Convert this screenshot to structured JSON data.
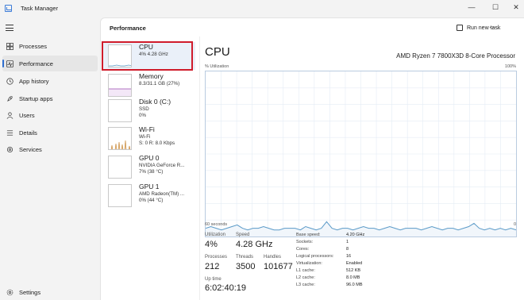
{
  "app": {
    "title": "Task Manager"
  },
  "window_controls": {
    "minimize": "—",
    "maximize": "☐",
    "close": "✕"
  },
  "nav": {
    "items": [
      {
        "label": "Processes"
      },
      {
        "label": "Performance"
      },
      {
        "label": "App history"
      },
      {
        "label": "Startup apps"
      },
      {
        "label": "Users"
      },
      {
        "label": "Details"
      },
      {
        "label": "Services"
      }
    ],
    "settings": "Settings",
    "active_index": 1
  },
  "header": {
    "title": "Performance",
    "run_task": "Run new task",
    "more": "···"
  },
  "resources": [
    {
      "name": "CPU",
      "line1": "4% 4.28 GHz",
      "line2": "",
      "line3": ""
    },
    {
      "name": "Memory",
      "line1": "8.3/31.1 GB (27%)",
      "line2": "",
      "line3": ""
    },
    {
      "name": "Disk 0 (C:)",
      "line1": "SSD",
      "line2": "0%",
      "line3": ""
    },
    {
      "name": "Wi-Fi",
      "line1": "Wi-Fi",
      "line2": "S: 0 R: 8.0 Kbps",
      "line3": ""
    },
    {
      "name": "GPU 0",
      "line1": "NVIDIA GeForce R...",
      "line2": "7% (38 °C)",
      "line3": ""
    },
    {
      "name": "GPU 1",
      "line1": "AMD Radeon(TM) ...",
      "line2": "0% (44 °C)",
      "line3": ""
    }
  ],
  "detail": {
    "title": "CPU",
    "processor": "AMD Ryzen 7 7800X3D 8-Core Processor",
    "util_label": "% Utilization",
    "util_max": "100%",
    "axis_left": "60 seconds",
    "axis_right": "0",
    "utilization_series": [
      5,
      6,
      5,
      4,
      5,
      6,
      7,
      5,
      4,
      5,
      5,
      6,
      5,
      4,
      4,
      5,
      5,
      5,
      4,
      6,
      5,
      4,
      5,
      9,
      5,
      4,
      5,
      5,
      4,
      5,
      6,
      5,
      5,
      4,
      5,
      6,
      5,
      4,
      5,
      5,
      5,
      4,
      5,
      6,
      5,
      4,
      5,
      5,
      4,
      5,
      6,
      8,
      5,
      4,
      5,
      4,
      5,
      4,
      5,
      4
    ]
  },
  "stats": {
    "utilization_label": "Utilization",
    "utilization": "4%",
    "speed_label": "Speed",
    "speed": "4.28 GHz",
    "processes_label": "Processes",
    "processes": "212",
    "threads_label": "Threads",
    "threads": "3500",
    "handles_label": "Handles",
    "handles": "101677",
    "uptime_label": "Up time",
    "uptime": "6:02:40:19"
  },
  "specs": [
    {
      "key": "Base speed:",
      "value": "4.20 GHz"
    },
    {
      "key": "Sockets:",
      "value": "1"
    },
    {
      "key": "Cores:",
      "value": "8"
    },
    {
      "key": "Logical processors:",
      "value": "16"
    },
    {
      "key": "Virtualization:",
      "value": "Enabled"
    },
    {
      "key": "L1 cache:",
      "value": "512 KB"
    },
    {
      "key": "L2 cache:",
      "value": "8.0 MB"
    },
    {
      "key": "L3 cache:",
      "value": "96.0 MB"
    }
  ],
  "colors": {
    "cpu_line": "#5a9ac8",
    "memory_line": "#9b4db0",
    "wifi_bars": "#c98a3a",
    "selection": "#d01c2b",
    "accent": "#2e6ecf"
  }
}
